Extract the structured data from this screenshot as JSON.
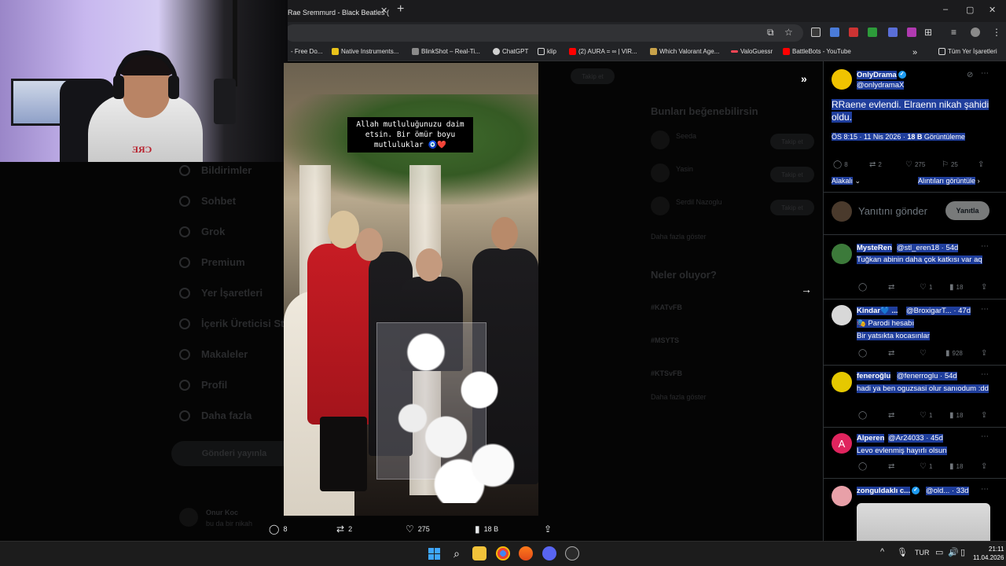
{
  "browser": {
    "tab_title": "Rae Sremmurd - Black Beatles (",
    "new_tab": "+",
    "window_controls": [
      "–",
      "▢",
      "✕"
    ],
    "bookmarks": [
      {
        "label": "- Free Do...",
        "color": "#2f2f2f"
      },
      {
        "label": "Native Instruments...",
        "color": "#e8c21a"
      },
      {
        "label": "BlinkShot – Real-Ti...",
        "color": "#8a8a8a"
      },
      {
        "label": "ChatGPT",
        "color": "#d0d0d0"
      },
      {
        "label": "klip",
        "color": "#d9d9d9"
      },
      {
        "label": "(2) AURA = ∞ | VIR...",
        "color": "#ff0000"
      },
      {
        "label": "Which Valorant Age...",
        "color": "#c8a24a"
      },
      {
        "label": "ValoGuessr",
        "color": "#ff4655"
      },
      {
        "label": "BattleBots - YouTube",
        "color": "#ff0000"
      }
    ],
    "bookmarks_overflow": "»",
    "all_bookmarks": "Tüm Yer İşaretleri"
  },
  "background_page": {
    "nav": [
      "Bildirimler",
      "Sohbet",
      "Grok",
      "Premium",
      "Yer İşaretleri",
      "İçerik Üreticisi St",
      "Makaleler",
      "Profil",
      "Daha fazla"
    ],
    "post_button": "Gönderi yayınla",
    "follow_button": "Takip et",
    "who_to_follow_title": "Bunları beğenebilirsin",
    "follow_suggestions": [
      "Seeda",
      "Yasin",
      "Serdil Nazoglu"
    ],
    "trends_title": "Neler oluyor?",
    "trends": [
      "#KATvFB",
      "#MSYTS",
      "#KTSvFB"
    ],
    "show_more": "Daha fazla göster",
    "ghost_author": "Onur Koc",
    "ghost_text": "bu da bir nikah"
  },
  "video": {
    "caption_line1": "Allah mutluluğunuzu daim",
    "caption_line2": "etsin. Bir ömür boyu",
    "caption_line3": "mutluluklar 🧿❤️"
  },
  "media_nav": {
    "expand": "»",
    "next": "→"
  },
  "engagement": {
    "replies": "8",
    "reposts": "2",
    "likes": "275",
    "views": "18 B"
  },
  "panel": {
    "author_name": "OnlyDrama",
    "author_handle": "@onlydramaX",
    "tweet_text": "RRaene evlendi. Elraenn nikah şahidi oldu.",
    "timestamp": "ÖS 8:15 · 11 Nis 2026 · ",
    "views_count": "18 B",
    "views_label": " Görüntüleme",
    "stats": {
      "replies": "8",
      "reposts": "2",
      "likes": "275",
      "bookmarks": "25"
    },
    "sort_label": "Alakalı",
    "quotes_link": "Alıntıları görüntüle",
    "reply_placeholder": "Yanıtını gönder",
    "reply_button": "Yanıtla",
    "replies": [
      {
        "name": "MysteRen",
        "handle": "@stl_eren18 · 54d",
        "text": "Tuğkan abinin daha çok katkısı var aq",
        "likes": "1",
        "views": "18",
        "avatar_color": "#3c7a3a"
      },
      {
        "name": "Kindar💙 ...",
        "handle": "@BroxigarT... · 47d",
        "badge": "🎭 Parodi hesabı",
        "text": "Bir yatsıkta kocasınlar",
        "likes": "",
        "views": "928",
        "avatar_color": "#d8d8d8"
      },
      {
        "name": "feneroğlu",
        "handle": "@fenerroglu · 54d",
        "text": "hadi ya ben oguzsasi olur sanıodum :dd",
        "likes": "1",
        "views": "18",
        "avatar_color": "#e5c800"
      },
      {
        "name": "Alperen",
        "handle": "@Ar24033 · 45d",
        "text": "Levo evlenmiş hayırlı olsun",
        "likes": "1",
        "views": "18",
        "avatar_color": "#e0245e",
        "avatar_letter": "A"
      },
      {
        "name": "zonguldaklı c...",
        "handle": "@old... · 33d",
        "text": "",
        "likes": "",
        "views": "",
        "avatar_color": "#e8a0a8"
      }
    ]
  },
  "taskbar": {
    "language": "TUR",
    "time": "21:11",
    "date": "11.04.2026",
    "overflow": "^"
  }
}
